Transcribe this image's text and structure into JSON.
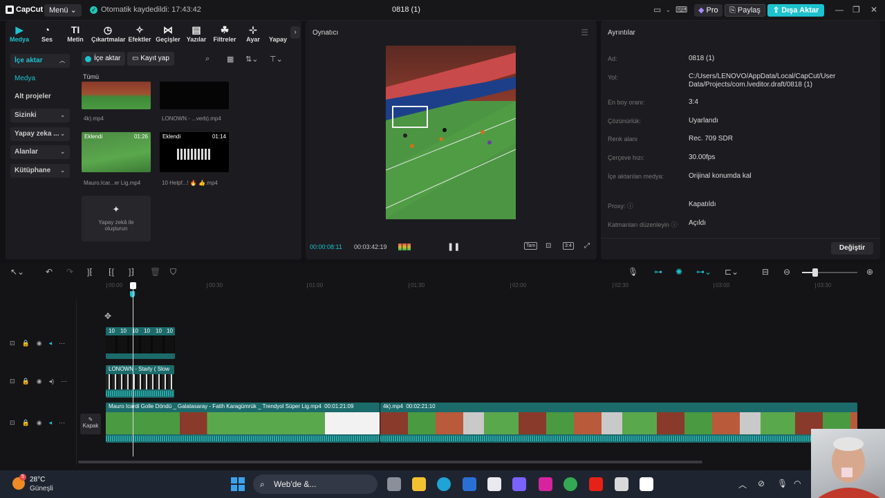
{
  "app": {
    "logo": "CapCut",
    "menu_label": "Menü",
    "autosave": "Otomatik kaydedildi: 17:43:42",
    "project_title": "0818 (1)",
    "pro_label": "Pro",
    "share_label": "Paylaş",
    "export_label": "Dışa Aktar"
  },
  "tool_tabs": [
    {
      "label": "Medya",
      "icon": "media-icon"
    },
    {
      "label": "Ses",
      "icon": "audio-icon"
    },
    {
      "label": "Metin",
      "icon": "text-icon"
    },
    {
      "label": "Çıkartmalar",
      "icon": "sticker-icon"
    },
    {
      "label": "Efektler",
      "icon": "effects-icon"
    },
    {
      "label": "Geçişler",
      "icon": "transitions-icon"
    },
    {
      "label": "Yazılar",
      "icon": "captions-icon"
    },
    {
      "label": "Filtreler",
      "icon": "filters-icon"
    },
    {
      "label": "Ayar",
      "icon": "adjust-icon"
    },
    {
      "label": "Yapay",
      "icon": "ai-icon"
    }
  ],
  "sidebar": {
    "items": [
      {
        "label": "İçe aktar"
      },
      {
        "label": "Medya"
      },
      {
        "label": "Alt projeler"
      },
      {
        "label": "Sizinki"
      },
      {
        "label": "Yapay zeka ..."
      },
      {
        "label": "Alanlar"
      },
      {
        "label": "Kütüphane"
      }
    ]
  },
  "media": {
    "import_label": "İçe aktar",
    "record_label": "Kayıt yap",
    "all_label": "Tümü",
    "items": [
      {
        "name": "4k).mp4",
        "badge": "",
        "duration": ""
      },
      {
        "name": "LONOWN - ...verb).mp4",
        "badge": "",
        "duration": ""
      },
      {
        "name": "Mauro.Icar...er Lig.mp4",
        "badge": "Eklendi",
        "duration": "01:26"
      },
      {
        "name": "10 Helpf...! 🔥 👍.mp4",
        "badge": "Eklendi",
        "duration": "01:14"
      }
    ],
    "ai_card": {
      "line1": "Yapay zekâ ile",
      "line2": "oluşturun"
    }
  },
  "player": {
    "title": "Oynatıcı",
    "current_time": "00:00:08:11",
    "total_time": "00:03:42:19",
    "full_label": "Tam",
    "ratio_label": "3:4"
  },
  "details": {
    "title": "Ayrıntılar",
    "rows": [
      {
        "label": "Ad:",
        "value": "0818 (1)"
      },
      {
        "label": "Yol:",
        "value": "C:/Users/LENOVO/AppData/Local/CapCut/User Data/Projects/com.lveditor.draft/0818 (1)"
      },
      {
        "label": "En boy oranı:",
        "value": "3:4"
      },
      {
        "label": "Çözünürlük:",
        "value": "Uyarlandı"
      },
      {
        "label": "Renk alanı",
        "value": "Rec. 709 SDR"
      },
      {
        "label": "Çerçeve hızı:",
        "value": "30.00fps"
      },
      {
        "label": "İçe aktarılan medya:",
        "value": "Orijinal konumda kal"
      },
      {
        "label": "Proxy:",
        "value": "Kapatıldı"
      },
      {
        "label": "Katmanları düzenleyin",
        "value": "Açıldı"
      }
    ],
    "change_label": "Değiştir"
  },
  "timeline": {
    "ruler": [
      "00:00",
      "00:30",
      "01:00",
      "01:30",
      "02:00",
      "02:30",
      "03:00",
      "03:30"
    ],
    "cover_label": "Kapak",
    "clips": {
      "text_clip_label": "10",
      "audio_clip_label": "LONOWN - Starly ( Slow",
      "main_clip1_label": "Mauro Icardi Golle Döndü _ Galatasaray - Fatih Karagümrük _ Trendyol Süper Lig.mp4",
      "main_clip1_duration": "00:01:21:09",
      "main_clip2_label": "4k).mp4",
      "main_clip2_duration": "00:02:21:10"
    }
  },
  "taskbar": {
    "temperature": "28°C",
    "weather": "Güneşli",
    "weather_badge": "5",
    "search_placeholder": "Web'de &..."
  },
  "colors": {
    "accent": "#1ec2ce",
    "bg": "#121214",
    "panel": "#1c1c20"
  }
}
